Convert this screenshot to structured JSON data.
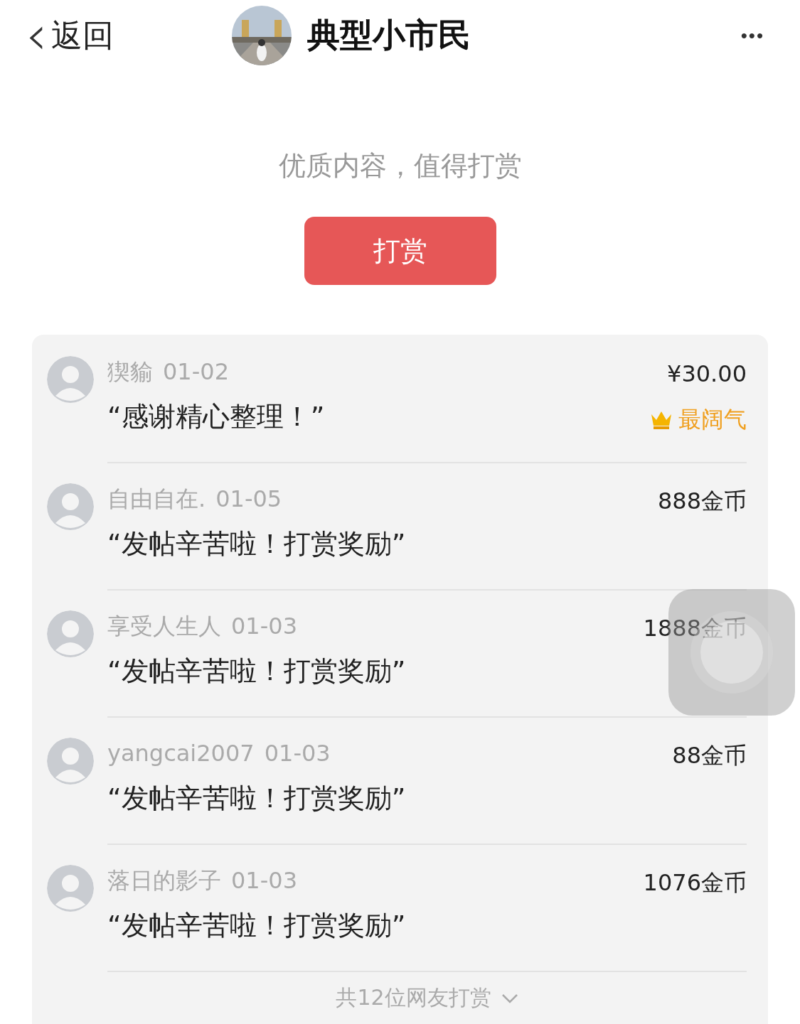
{
  "nav": {
    "back_icon": "‹",
    "back_label": "返回",
    "title": "典型小市民",
    "more": "•••"
  },
  "prompt": "优质内容，值得打赏",
  "reward_button": "打赏",
  "rewards": [
    {
      "name": "猰貐",
      "date": "01-02",
      "comment": "“感谢精心整理！”",
      "amount": "¥30.00",
      "badge": "最阔气"
    },
    {
      "name": "自由自在.",
      "date": "01-05",
      "comment": "“发帖辛苦啦！打赏奖励”",
      "amount": "888金币"
    },
    {
      "name": "享受人生人",
      "date": "01-03",
      "comment": "“发帖辛苦啦！打赏奖励”",
      "amount": "1888金币"
    },
    {
      "name": "yangcai2007",
      "date": "01-03",
      "comment": "“发帖辛苦啦！打赏奖励”",
      "amount": "88金币"
    },
    {
      "name": "落日的影子",
      "date": "01-03",
      "comment": "“发帖辛苦啦！打赏奖励”",
      "amount": "1076金币"
    }
  ],
  "footer": "共12位网友打赏"
}
